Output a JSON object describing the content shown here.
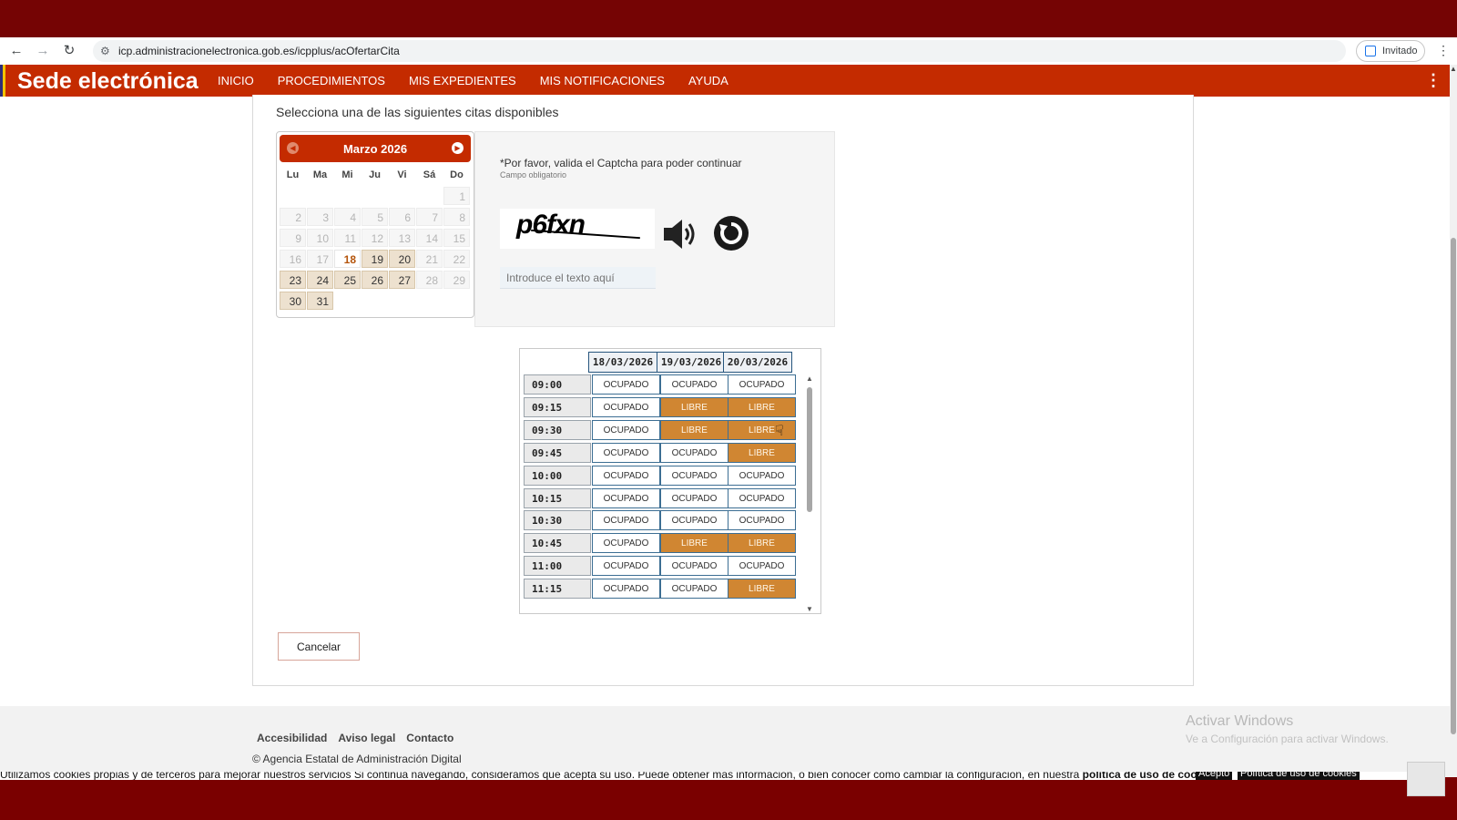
{
  "browser": {
    "url": "icp.administracionelectronica.gob.es/icpplus/acOfertarCita",
    "profile_label": "Invitado"
  },
  "header": {
    "brand": "Sede electrónica",
    "nav": [
      "INICIO",
      "PROCEDIMIENTOS",
      "MIS EXPEDIENTES",
      "MIS NOTIFICACIONES",
      "AYUDA"
    ]
  },
  "main": {
    "intro": "Selecciona una de las siguientes citas disponibles"
  },
  "calendar": {
    "title": "Marzo 2026",
    "weekdays": [
      "Lu",
      "Ma",
      "Mi",
      "Ju",
      "Vi",
      "Sá",
      "Do"
    ],
    "weeks": [
      [
        null,
        null,
        null,
        null,
        null,
        null,
        {
          "d": "1",
          "s": "dis"
        }
      ],
      [
        {
          "d": "2",
          "s": "dis"
        },
        {
          "d": "3",
          "s": "dis"
        },
        {
          "d": "4",
          "s": "dis"
        },
        {
          "d": "5",
          "s": "dis"
        },
        {
          "d": "6",
          "s": "dis"
        },
        {
          "d": "7",
          "s": "dis"
        },
        {
          "d": "8",
          "s": "dis"
        }
      ],
      [
        {
          "d": "9",
          "s": "dis"
        },
        {
          "d": "10",
          "s": "dis"
        },
        {
          "d": "11",
          "s": "dis"
        },
        {
          "d": "12",
          "s": "dis"
        },
        {
          "d": "13",
          "s": "dis"
        },
        {
          "d": "14",
          "s": "dis"
        },
        {
          "d": "15",
          "s": "dis"
        }
      ],
      [
        {
          "d": "16",
          "s": "dis"
        },
        {
          "d": "17",
          "s": "dis"
        },
        {
          "d": "18",
          "s": "sel"
        },
        {
          "d": "19",
          "s": "av"
        },
        {
          "d": "20",
          "s": "av"
        },
        {
          "d": "21",
          "s": "dis"
        },
        {
          "d": "22",
          "s": "dis"
        }
      ],
      [
        {
          "d": "23",
          "s": "av"
        },
        {
          "d": "24",
          "s": "av"
        },
        {
          "d": "25",
          "s": "av"
        },
        {
          "d": "26",
          "s": "av"
        },
        {
          "d": "27",
          "s": "av"
        },
        {
          "d": "28",
          "s": "dis"
        },
        {
          "d": "29",
          "s": "dis"
        }
      ],
      [
        {
          "d": "30",
          "s": "av"
        },
        {
          "d": "31",
          "s": "av"
        },
        null,
        null,
        null,
        null,
        null
      ]
    ]
  },
  "captcha": {
    "message": "*Por favor, valida el Captcha para poder continuar",
    "required": "Campo obligatorio",
    "image_text": "p6fxn",
    "input_placeholder": "Introduce el texto aquí",
    "audio_icon": "speaker-icon",
    "refresh_icon": "refresh-icon"
  },
  "slots": {
    "dates": [
      "18/03/2026",
      "19/03/2026",
      "20/03/2026"
    ],
    "rows": [
      {
        "time": "09:00",
        "cells": [
          "OCUPADO",
          "OCUPADO",
          "OCUPADO"
        ]
      },
      {
        "time": "09:15",
        "cells": [
          "OCUPADO",
          "LIBRE",
          "LIBRE"
        ]
      },
      {
        "time": "09:30",
        "cells": [
          "OCUPADO",
          "LIBRE",
          "LIBRE"
        ]
      },
      {
        "time": "09:45",
        "cells": [
          "OCUPADO",
          "OCUPADO",
          "LIBRE"
        ]
      },
      {
        "time": "10:00",
        "cells": [
          "OCUPADO",
          "OCUPADO",
          "OCUPADO"
        ]
      },
      {
        "time": "10:15",
        "cells": [
          "OCUPADO",
          "OCUPADO",
          "OCUPADO"
        ]
      },
      {
        "time": "10:30",
        "cells": [
          "OCUPADO",
          "OCUPADO",
          "OCUPADO"
        ]
      },
      {
        "time": "10:45",
        "cells": [
          "OCUPADO",
          "LIBRE",
          "LIBRE"
        ]
      },
      {
        "time": "11:00",
        "cells": [
          "OCUPADO",
          "OCUPADO",
          "OCUPADO"
        ]
      },
      {
        "time": "11:15",
        "cells": [
          "OCUPADO",
          "OCUPADO",
          "LIBRE"
        ]
      }
    ],
    "colors": {
      "libre": "#d08632",
      "ocupado": "#ffffff",
      "border": "#3c6e93"
    }
  },
  "actions": {
    "cancel_label": "Cancelar"
  },
  "footer": {
    "links": [
      "Accesibilidad",
      "Aviso legal",
      "Contacto"
    ],
    "copyright": "© Agencia Estatal de Administración Digital"
  },
  "windows_watermark": {
    "title": "Activar Windows",
    "subtitle": "Ve a Configuración para activar Windows."
  },
  "cookie_bar": {
    "text": "Utilizamos cookies propias y de terceros para mejorar nuestros servicios Si continúa navegando, consideramos que acepta su uso. Puede obtener más información, o bien conocer cómo cambiar la configuración, en nuestra",
    "link": "política de uso de cookies",
    "accept_label": "Acepto",
    "policy_label": "Política de uso de cookies"
  },
  "theme": {
    "brand_red": "#c42b00",
    "frame_red": "#750404"
  }
}
